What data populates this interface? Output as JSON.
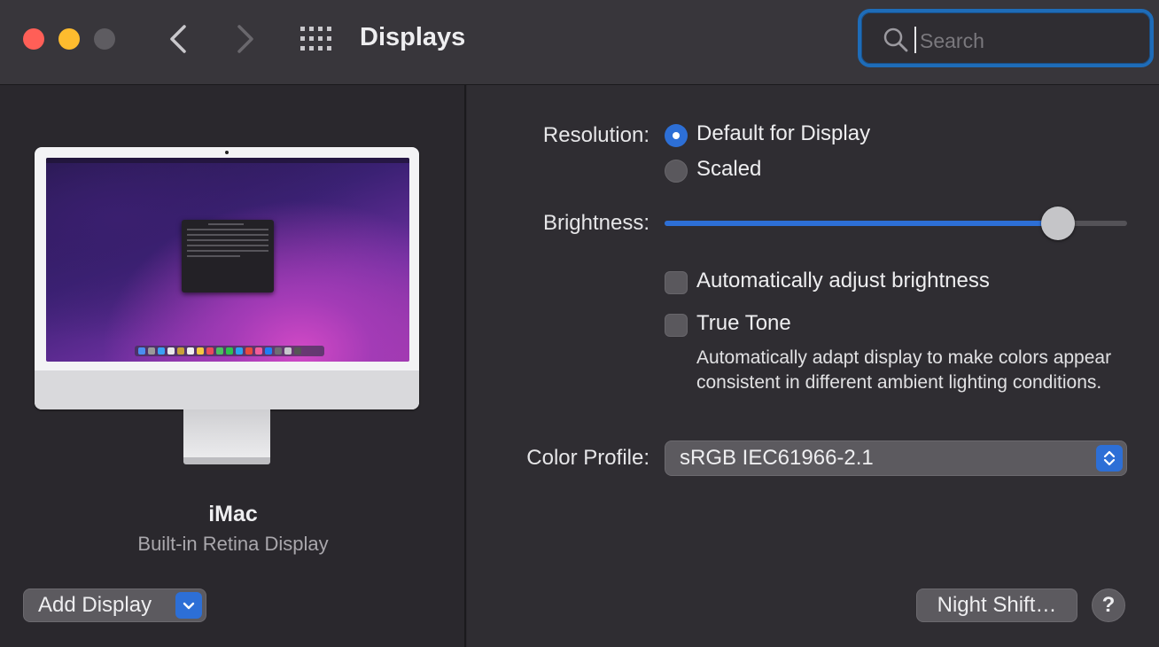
{
  "window": {
    "title": "Displays",
    "search_placeholder": "Search"
  },
  "device": {
    "name": "iMac",
    "subtitle": "Built-in Retina Display"
  },
  "buttons": {
    "add_display": "Add Display",
    "night_shift": "Night Shift…",
    "help": "?"
  },
  "settings": {
    "resolution_label": "Resolution:",
    "resolution_options": [
      "Default for Display",
      "Scaled"
    ],
    "resolution_selected": "Default for Display",
    "brightness_label": "Brightness:",
    "brightness_level": 0.85,
    "auto_brightness_label": "Automatically adjust brightness",
    "auto_brightness_checked": false,
    "true_tone_label": "True Tone",
    "true_tone_checked": false,
    "true_tone_description": "Automatically adapt display to make colors appear consistent in different ambient lighting conditions.",
    "color_profile_label": "Color Profile:",
    "color_profile_value": "sRGB IEC61966-2.1"
  },
  "colors": {
    "accent": "#2d6fd6",
    "close": "#ff5f57",
    "minimize": "#febc2e",
    "zoom_disabled": "#5e5c61"
  },
  "icons": [
    "back-chevron-icon",
    "forward-chevron-icon",
    "grid-icon",
    "search-icon",
    "chevron-down-icon",
    "chevron-updown-icon"
  ]
}
